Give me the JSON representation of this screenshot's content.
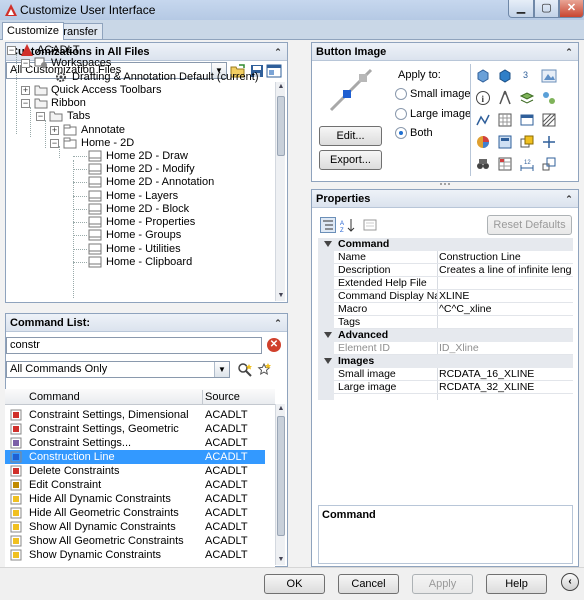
{
  "window": {
    "title": "Customize User Interface"
  },
  "tabs": [
    {
      "label": "Customize"
    },
    {
      "label": "Transfer"
    }
  ],
  "customizations": {
    "header": "Customizations in All Files",
    "filter_value": "All Customization Files",
    "tree": [
      {
        "label": "ACADLT"
      },
      {
        "label": "Workspaces"
      },
      {
        "label": "Drafting & Annotation Default (current)"
      },
      {
        "label": "Quick Access Toolbars"
      },
      {
        "label": "Ribbon"
      },
      {
        "label": "Tabs"
      },
      {
        "label": "Annotate"
      },
      {
        "label": "Home - 2D"
      },
      {
        "label": "Home 2D - Draw"
      },
      {
        "label": "Home 2D - Modify"
      },
      {
        "label": "Home 2D - Annotation"
      },
      {
        "label": "Home - Layers"
      },
      {
        "label": "Home 2D - Block"
      },
      {
        "label": "Home - Properties"
      },
      {
        "label": "Home - Groups"
      },
      {
        "label": "Home - Utilities"
      },
      {
        "label": "Home - Clipboard"
      }
    ]
  },
  "command_list": {
    "header": "Command List:",
    "search_value": "constr",
    "filter_value": "All Commands Only",
    "columns": {
      "command": "Command",
      "source": "Source"
    },
    "rows": [
      {
        "name": "Constraint Settings, Dimensional",
        "source": "ACADLT"
      },
      {
        "name": "Constraint Settings, Geometric",
        "source": "ACADLT"
      },
      {
        "name": "Constraint Settings...",
        "source": "ACADLT"
      },
      {
        "name": "Construction Line",
        "source": "ACADLT",
        "selected": true
      },
      {
        "name": "Delete Constraints",
        "source": "ACADLT"
      },
      {
        "name": "Edit Constraint",
        "source": "ACADLT"
      },
      {
        "name": "Hide All Dynamic Constraints",
        "source": "ACADLT"
      },
      {
        "name": "Hide All Geometric Constraints",
        "source": "ACADLT"
      },
      {
        "name": "Show All Dynamic Constraints",
        "source": "ACADLT"
      },
      {
        "name": "Show All Geometric Constraints",
        "source": "ACADLT"
      },
      {
        "name": "Show Dynamic Constraints",
        "source": "ACADLT"
      }
    ]
  },
  "button_image": {
    "header": "Button Image",
    "apply_to_label": "Apply to:",
    "small_image_label": "Small image",
    "large_image_label": "Large image",
    "both_label": "Both",
    "edit_label": "Edit...",
    "export_label": "Export..."
  },
  "properties": {
    "header": "Properties",
    "reset_label": "Reset Defaults",
    "categories": [
      {
        "name": "Command",
        "rows": [
          {
            "name": "Name",
            "value": "Construction Line"
          },
          {
            "name": "Description",
            "value": "Creates a line of infinite length"
          },
          {
            "name": "Extended Help File",
            "value": ""
          },
          {
            "name": "Command Display Name",
            "value": "XLINE"
          },
          {
            "name": "Macro",
            "value": "^C^C_xline"
          },
          {
            "name": "Tags",
            "value": ""
          }
        ]
      },
      {
        "name": "Advanced",
        "rows": [
          {
            "name": "Element ID",
            "value": "ID_Xline",
            "disabled": true
          }
        ]
      },
      {
        "name": "Images",
        "rows": [
          {
            "name": "Small image",
            "value": "RCDATA_16_XLINE"
          },
          {
            "name": "Large image",
            "value": "RCDATA_32_XLINE"
          }
        ]
      }
    ],
    "description_title": "Command"
  },
  "buttons": {
    "ok": "OK",
    "cancel": "Cancel",
    "apply": "Apply",
    "help": "Help"
  },
  "colors": {
    "accent": "#3399ff",
    "panel_border": "#8fa3bd",
    "close_red": "#c84530",
    "autocad_red": "#d0302a"
  }
}
